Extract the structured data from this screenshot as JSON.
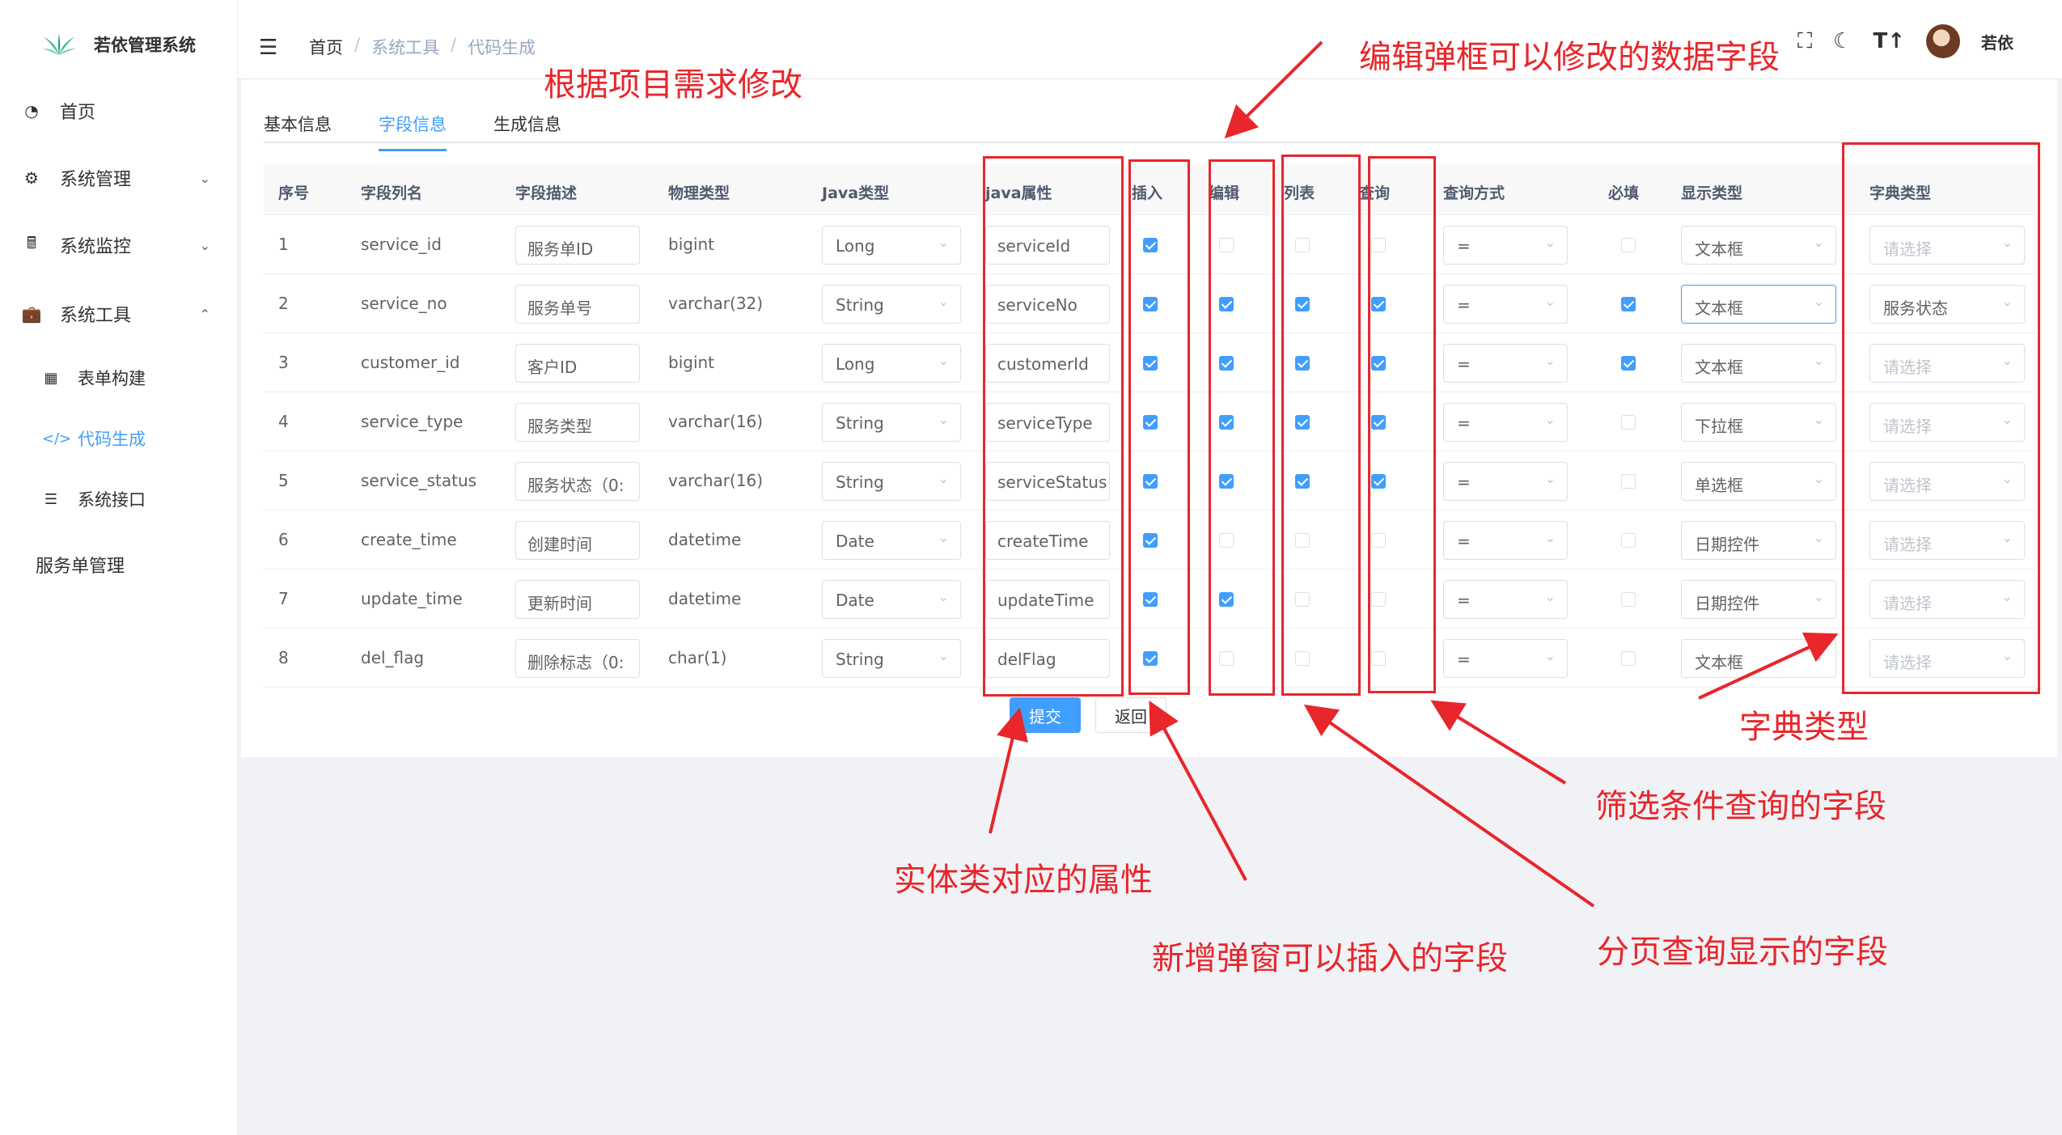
{
  "sidebar": {
    "title": "若依管理系统",
    "items": [
      {
        "label": "首页",
        "icon": "dashboard-icon"
      },
      {
        "label": "系统管理",
        "icon": "gear-icon"
      },
      {
        "label": "系统监控",
        "icon": "monitor-icon"
      },
      {
        "label": "系统工具",
        "icon": "toolbox-icon"
      }
    ],
    "subitems": [
      {
        "label": "表单构建",
        "icon": "table-icon"
      },
      {
        "label": "代码生成",
        "icon": "code-icon"
      },
      {
        "label": "系统接口",
        "icon": "sliders-icon"
      }
    ],
    "extra": "服务单管理"
  },
  "header": {
    "breadcrumb": [
      "首页",
      "系统工具",
      "代码生成"
    ],
    "separator": "/",
    "username": "若依"
  },
  "tabs": [
    "基本信息",
    "字段信息",
    "生成信息"
  ],
  "columns": [
    "序号",
    "字段列名",
    "字段描述",
    "物理类型",
    "Java类型",
    "java属性",
    "插入",
    "编辑",
    "列表",
    "查询",
    "查询方式",
    "必填",
    "显示类型",
    "字典类型"
  ],
  "rows": [
    {
      "no": "1",
      "name": "service_id",
      "desc": "服务单ID",
      "phys": "bigint",
      "java": "Long",
      "attr": "serviceId",
      "ins": true,
      "edit": false,
      "list": false,
      "query": false,
      "qtype": "=",
      "req": false,
      "show": "文本框",
      "dict": "请选择",
      "dict_placeholder": true
    },
    {
      "no": "2",
      "name": "service_no",
      "desc": "服务单号",
      "phys": "varchar(32)",
      "java": "String",
      "attr": "serviceNo",
      "ins": true,
      "edit": true,
      "list": true,
      "query": true,
      "qtype": "=",
      "req": true,
      "show": "文本框",
      "dict": "服务状态",
      "dict_placeholder": false
    },
    {
      "no": "3",
      "name": "customer_id",
      "desc": "客户ID",
      "phys": "bigint",
      "java": "Long",
      "attr": "customerId",
      "ins": true,
      "edit": true,
      "list": true,
      "query": true,
      "qtype": "=",
      "req": true,
      "show": "文本框",
      "dict": "请选择",
      "dict_placeholder": true
    },
    {
      "no": "4",
      "name": "service_type",
      "desc": "服务类型",
      "phys": "varchar(16)",
      "java": "String",
      "attr": "serviceType",
      "ins": true,
      "edit": true,
      "list": true,
      "query": true,
      "qtype": "=",
      "req": false,
      "show": "下拉框",
      "dict": "请选择",
      "dict_placeholder": true
    },
    {
      "no": "5",
      "name": "service_status",
      "desc": "服务状态（0:",
      "phys": "varchar(16)",
      "java": "String",
      "attr": "serviceStatus",
      "ins": true,
      "edit": true,
      "list": true,
      "query": true,
      "qtype": "=",
      "req": false,
      "show": "单选框",
      "dict": "请选择",
      "dict_placeholder": true
    },
    {
      "no": "6",
      "name": "create_time",
      "desc": "创建时间",
      "phys": "datetime",
      "java": "Date",
      "attr": "createTime",
      "ins": true,
      "edit": false,
      "list": false,
      "query": false,
      "qtype": "=",
      "req": false,
      "show": "日期控件",
      "dict": "请选择",
      "dict_placeholder": true
    },
    {
      "no": "7",
      "name": "update_time",
      "desc": "更新时间",
      "phys": "datetime",
      "java": "Date",
      "attr": "updateTime",
      "ins": true,
      "edit": true,
      "list": false,
      "query": false,
      "qtype": "=",
      "req": false,
      "show": "日期控件",
      "dict": "请选择",
      "dict_placeholder": true
    },
    {
      "no": "8",
      "name": "del_flag",
      "desc": "删除标志（0:",
      "phys": "char(1)",
      "java": "String",
      "attr": "delFlag",
      "ins": true,
      "edit": false,
      "list": false,
      "query": false,
      "qtype": "=",
      "req": false,
      "show": "文本框",
      "dict": "请选择",
      "dict_placeholder": true
    }
  ],
  "buttons": {
    "submit": "提交",
    "back": "返回"
  },
  "annotations": {
    "modify": "根据项目需求修改",
    "edit_fields": "编辑弹框可以修改的数据字段",
    "dict_type": "字典类型",
    "filter_fields": "筛选条件查询的字段",
    "entity_attr": "实体类对应的属性",
    "page_fields": "分页查询显示的字段",
    "insert_fields": "新增弹窗可以插入的字段"
  },
  "colors": {
    "accent": "#409eff",
    "annotation": "#e8262b"
  }
}
